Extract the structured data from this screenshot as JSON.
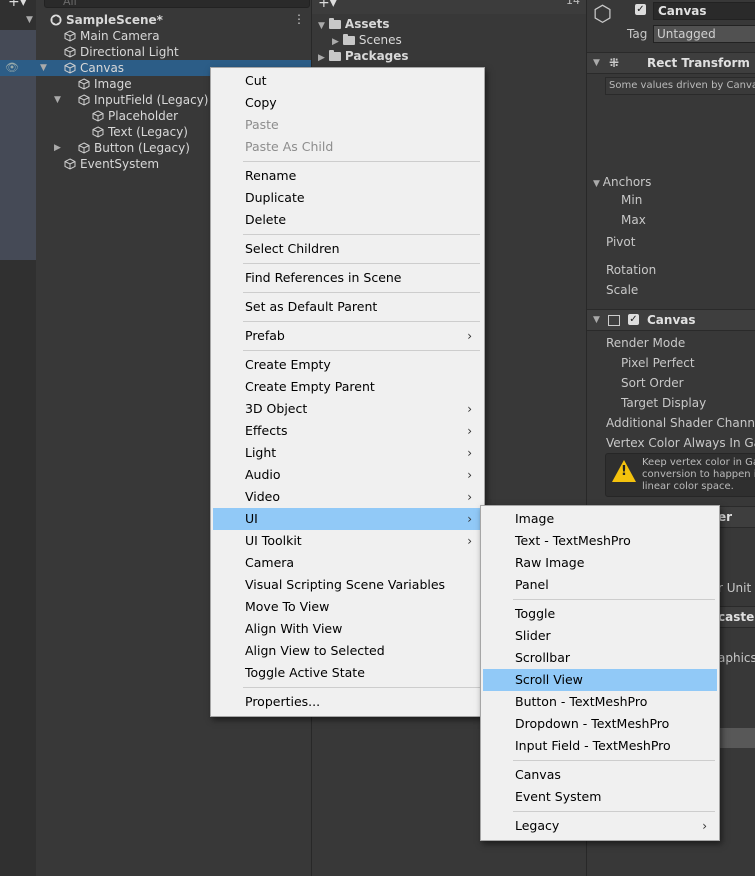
{
  "hierarchy": {
    "search_placeholder": "All",
    "add_label": "+▾",
    "items": [
      {
        "label": "SampleScene*",
        "depth": 0,
        "expanded": true,
        "selected": false
      },
      {
        "label": "Main Camera",
        "depth": 1,
        "expanded": null,
        "selected": false
      },
      {
        "label": "Directional Light",
        "depth": 1,
        "expanded": null,
        "selected": false
      },
      {
        "label": "Canvas",
        "depth": 1,
        "expanded": true,
        "selected": true
      },
      {
        "label": "Image",
        "depth": 2,
        "expanded": null,
        "selected": false
      },
      {
        "label": "InputField (Legacy)",
        "depth": 2,
        "expanded": true,
        "selected": false
      },
      {
        "label": "Placeholder",
        "depth": 3,
        "expanded": null,
        "selected": false
      },
      {
        "label": "Text (Legacy)",
        "depth": 3,
        "expanded": null,
        "selected": false
      },
      {
        "label": "Button (Legacy)",
        "depth": 2,
        "expanded": false,
        "selected": false
      },
      {
        "label": "EventSystem",
        "depth": 1,
        "expanded": null,
        "selected": false
      }
    ]
  },
  "project": {
    "add_label": "+▾",
    "count_label": "14",
    "items": [
      {
        "label": "Assets",
        "depth": 0,
        "expanded": true
      },
      {
        "label": "Scenes",
        "depth": 1,
        "expanded": false
      },
      {
        "label": "Packages",
        "depth": 0,
        "expanded": false
      }
    ]
  },
  "inspector": {
    "object_name": "Canvas",
    "tag_label": "Tag",
    "tag_value": "Untagged",
    "rect_transform_title": "Rect Transform",
    "driven_note": "Some values driven by Canvas.",
    "rect_fields": {
      "anchors": "Anchors",
      "min": "Min",
      "max": "Max",
      "pivot": "Pivot",
      "rotation": "Rotation",
      "scale": "Scale"
    },
    "canvas_title": "Canvas",
    "canvas_fields": {
      "render_mode": "Render Mode",
      "pixel_perfect": "Pixel Perfect",
      "sort_order": "Sort Order",
      "target_display": "Target Display",
      "additional_shader": "Additional Shader Channels",
      "vertex_color": "Vertex Color Always In Gamma"
    },
    "warning_lines": [
      "Keep vertex color in Ga",
      "conversion to happen in",
      "linear color space."
    ],
    "partial_labels": {
      "scaler": "er",
      "unit": "r Unit",
      "raycaster": "caster",
      "graphics": "aphics"
    }
  },
  "context_menu": {
    "items": [
      {
        "label": "Cut",
        "disabled": false,
        "submenu": false
      },
      {
        "label": "Copy",
        "disabled": false,
        "submenu": false
      },
      {
        "label": "Paste",
        "disabled": true,
        "submenu": false
      },
      {
        "label": "Paste As Child",
        "disabled": true,
        "submenu": false
      },
      {
        "sep": true
      },
      {
        "label": "Rename",
        "disabled": false,
        "submenu": false
      },
      {
        "label": "Duplicate",
        "disabled": false,
        "submenu": false
      },
      {
        "label": "Delete",
        "disabled": false,
        "submenu": false
      },
      {
        "sep": true
      },
      {
        "label": "Select Children",
        "disabled": false,
        "submenu": false
      },
      {
        "sep": true
      },
      {
        "label": "Find References in Scene",
        "disabled": false,
        "submenu": false
      },
      {
        "sep": true
      },
      {
        "label": "Set as Default Parent",
        "disabled": false,
        "submenu": false
      },
      {
        "sep": true
      },
      {
        "label": "Prefab",
        "disabled": false,
        "submenu": true
      },
      {
        "sep": true
      },
      {
        "label": "Create Empty",
        "disabled": false,
        "submenu": false
      },
      {
        "label": "Create Empty Parent",
        "disabled": false,
        "submenu": false
      },
      {
        "label": "3D Object",
        "disabled": false,
        "submenu": true
      },
      {
        "label": "Effects",
        "disabled": false,
        "submenu": true
      },
      {
        "label": "Light",
        "disabled": false,
        "submenu": true
      },
      {
        "label": "Audio",
        "disabled": false,
        "submenu": true
      },
      {
        "label": "Video",
        "disabled": false,
        "submenu": true
      },
      {
        "label": "UI",
        "disabled": false,
        "submenu": true,
        "highlighted": true
      },
      {
        "label": "UI Toolkit",
        "disabled": false,
        "submenu": true
      },
      {
        "label": "Camera",
        "disabled": false,
        "submenu": false
      },
      {
        "label": "Visual Scripting Scene Variables",
        "disabled": false,
        "submenu": false
      },
      {
        "label": "Move To View",
        "disabled": false,
        "submenu": false
      },
      {
        "label": "Align With View",
        "disabled": false,
        "submenu": false
      },
      {
        "label": "Align View to Selected",
        "disabled": false,
        "submenu": false
      },
      {
        "label": "Toggle Active State",
        "disabled": false,
        "submenu": false
      },
      {
        "sep": true
      },
      {
        "label": "Properties...",
        "disabled": false,
        "submenu": false
      }
    ]
  },
  "ui_submenu": {
    "items": [
      {
        "label": "Image",
        "submenu": false
      },
      {
        "label": "Text - TextMeshPro",
        "submenu": false
      },
      {
        "label": "Raw Image",
        "submenu": false
      },
      {
        "label": "Panel",
        "submenu": false
      },
      {
        "sep": true
      },
      {
        "label": "Toggle",
        "submenu": false
      },
      {
        "label": "Slider",
        "submenu": false
      },
      {
        "label": "Scrollbar",
        "submenu": false
      },
      {
        "label": "Scroll View",
        "submenu": false,
        "highlighted": true
      },
      {
        "label": "Button - TextMeshPro",
        "submenu": false
      },
      {
        "label": "Dropdown - TextMeshPro",
        "submenu": false
      },
      {
        "label": "Input Field - TextMeshPro",
        "submenu": false
      },
      {
        "sep": true
      },
      {
        "label": "Canvas",
        "submenu": false
      },
      {
        "label": "Event System",
        "submenu": false
      },
      {
        "sep": true
      },
      {
        "label": "Legacy",
        "submenu": true
      }
    ]
  },
  "colors": {
    "highlight": "#91c9f7",
    "selection": "#2c5d87",
    "warning": "#f4c20d"
  }
}
